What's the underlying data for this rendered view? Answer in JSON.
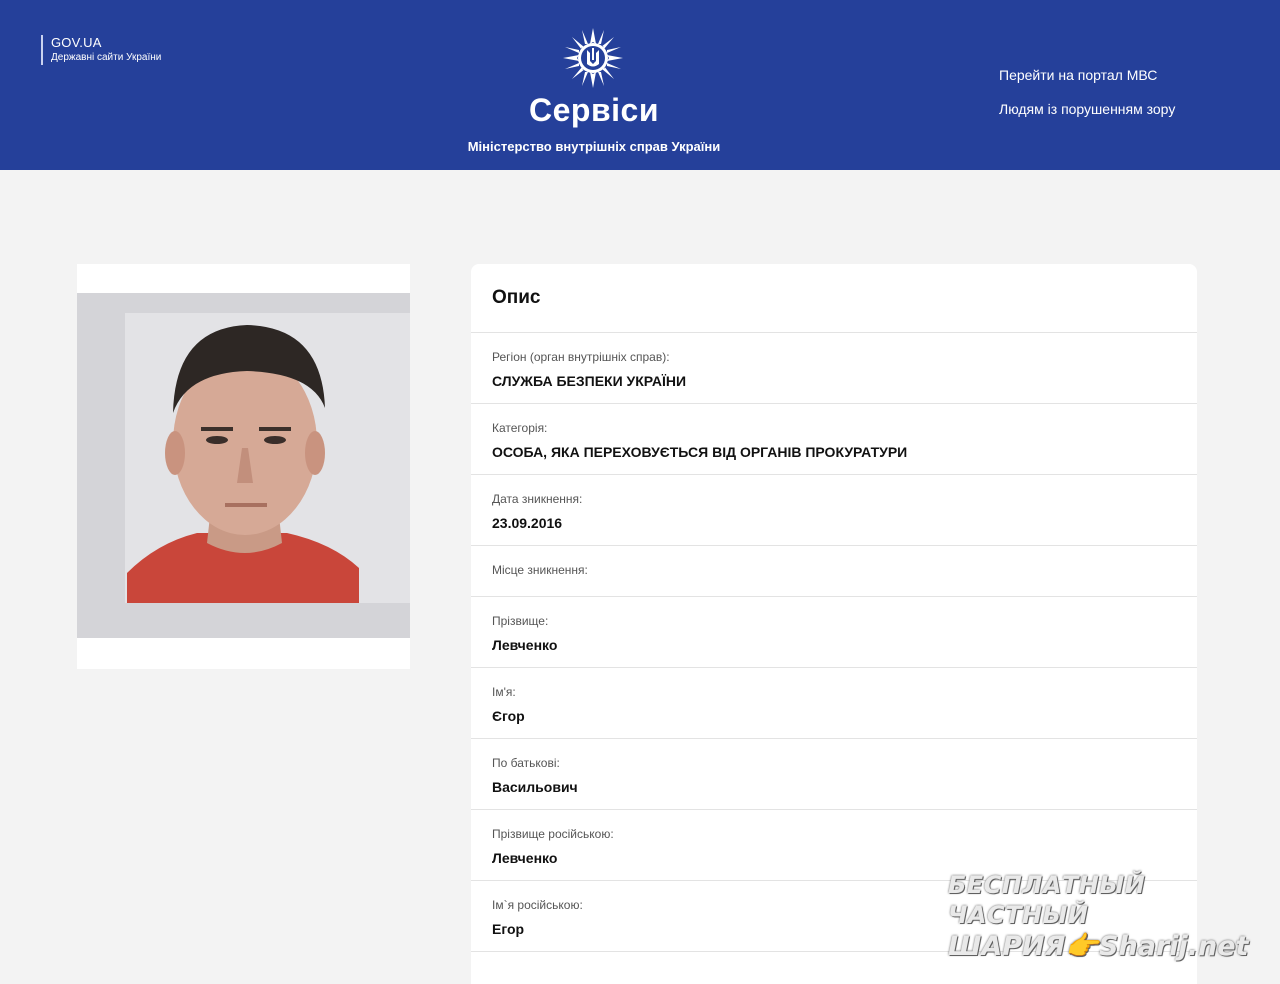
{
  "header": {
    "gov_title": "GOV.UA",
    "gov_subtitle": "Державні сайти України",
    "brand_title": "Сервіси",
    "brand_subtitle": "Міністерство внутрішніх справ України",
    "links": [
      "Перейти на портал МВС",
      "Людям із порушенням зору"
    ],
    "bg_color": "#25409a"
  },
  "info": {
    "title": "Опис",
    "fields": [
      {
        "label": "Регіон (орган внутрішніх справ):",
        "value": "СЛУЖБА БЕЗПЕКИ УКРАЇНИ"
      },
      {
        "label": "Категорія:",
        "value": "ОСОБА, ЯКА ПЕРЕХОВУЄТЬСЯ ВІД ОРГАНІВ ПРОКУРАТУРИ"
      },
      {
        "label": "Дата зникнення:",
        "value": "23.09.2016"
      },
      {
        "label": "Місце зникнення:",
        "value": ""
      },
      {
        "label": "Прізвище:",
        "value": "Левченко"
      },
      {
        "label": "Ім'я:",
        "value": "Єгор"
      },
      {
        "label": "По батькові:",
        "value": "Васильович"
      },
      {
        "label": "Прізвище російською:",
        "value": "Левченко"
      },
      {
        "label": "Ім`я російською:",
        "value": "Егор"
      }
    ]
  },
  "watermark": {
    "line1": "БЕСПЛАТНЫЙ ЧАСТНЫЙ",
    "line2": "ШАРИЯ👉Sharij.net"
  }
}
